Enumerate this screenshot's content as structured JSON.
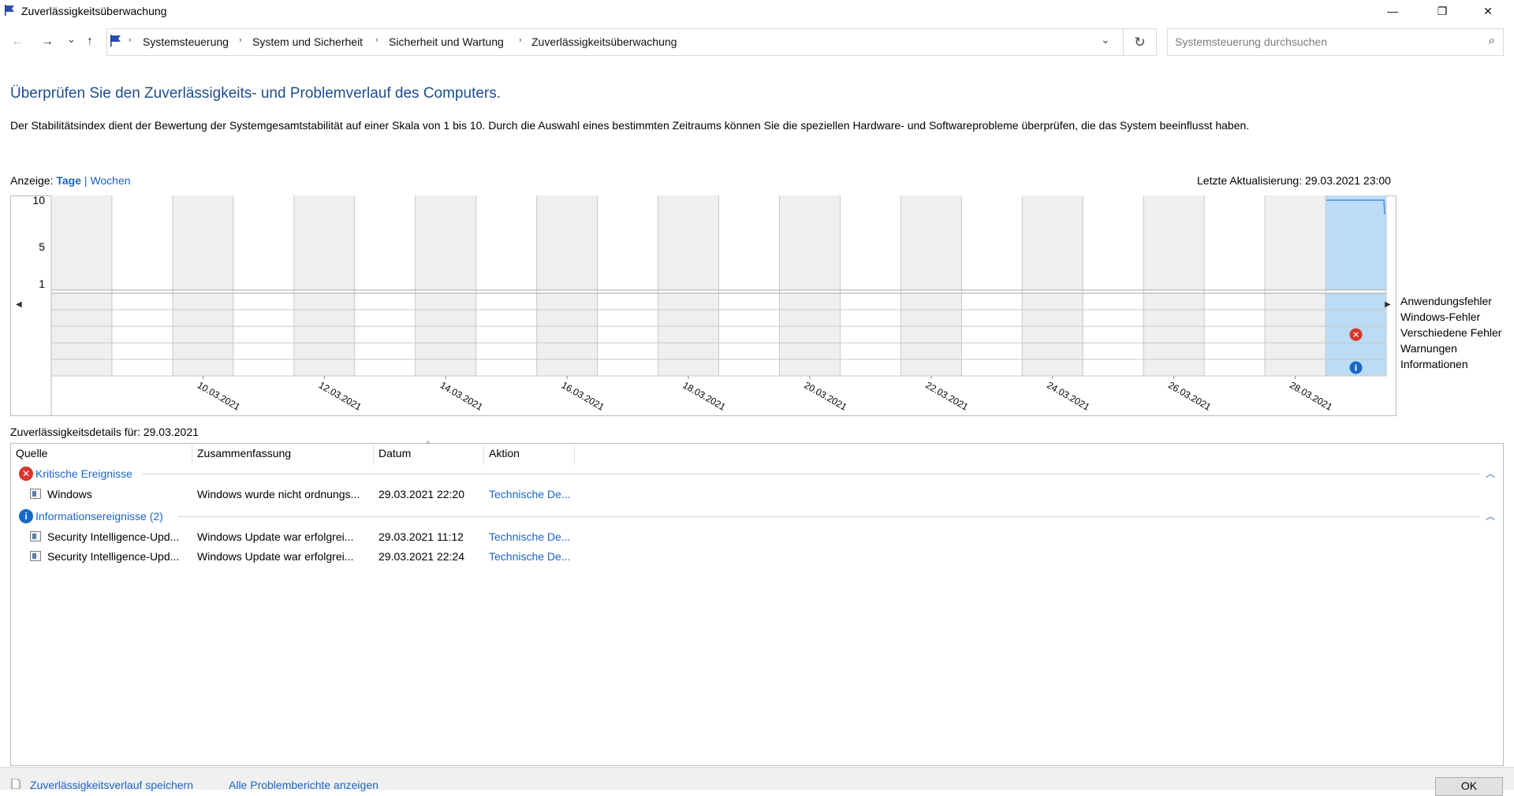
{
  "window": {
    "title": "Zuverlässigkeitsüberwachung",
    "icon": "flag-icon",
    "minimize_glyph": "—",
    "maximize_glyph": "❐",
    "close_glyph": "✕"
  },
  "nav": {
    "back_glyph": "←",
    "forward_glyph": "→",
    "recent_glyph": "⌄",
    "up_glyph": "↑",
    "breadcrumbs": [
      "Systemsteuerung",
      "System und Sicherheit",
      "Sicherheit und Wartung",
      "Zuverlässigkeitsüberwachung"
    ],
    "separator": "›",
    "dropdown_glyph": "⌄",
    "refresh_glyph": "↻"
  },
  "search": {
    "placeholder": "Systemsteuerung durchsuchen",
    "icon_glyph": "⌕"
  },
  "heading": "Überprüfen Sie den Zuverlässigkeits- und Problemverlauf des Computers.",
  "description": "Der Stabilitätsindex dient der Bewertung der Systemgesamtstabilität auf einer Skala von 1 bis 10. Durch die Auswahl eines bestimmten Zeitraums können Sie die speziellen Hardware- und Softwareprobleme überprüfen, die das System beeinflusst haben.",
  "view": {
    "label": "Anzeige:",
    "days": "Tage",
    "separator": "|",
    "weeks": "Wochen"
  },
  "last_update": "Letzte Aktualisierung: 29.03.2021 23:00",
  "chart_data": {
    "type": "line",
    "ylim": [
      1,
      10
    ],
    "y_ticks": [
      "10",
      "5",
      "1"
    ],
    "x_tick_labels": [
      "10.03.2021",
      "12.03.2021",
      "14.03.2021",
      "16.03.2021",
      "18.03.2021",
      "20.03.2021",
      "22.03.2021",
      "24.03.2021",
      "26.03.2021",
      "28.03.2021"
    ],
    "days": [
      "08.03.2021",
      "09.03.2021",
      "10.03.2021",
      "11.03.2021",
      "12.03.2021",
      "13.03.2021",
      "14.03.2021",
      "15.03.2021",
      "16.03.2021",
      "17.03.2021",
      "18.03.2021",
      "19.03.2021",
      "20.03.2021",
      "21.03.2021",
      "22.03.2021",
      "23.03.2021",
      "24.03.2021",
      "25.03.2021",
      "26.03.2021",
      "27.03.2021",
      "28.03.2021",
      "29.03.2021"
    ],
    "selected_day": "29.03.2021",
    "series": [
      {
        "values": [
          null,
          null,
          null,
          null,
          null,
          null,
          null,
          null,
          null,
          null,
          null,
          null,
          null,
          null,
          null,
          null,
          null,
          null,
          null,
          null,
          null,
          10
        ]
      }
    ],
    "event_rows": [
      "Anwendungsfehler",
      "Windows-Fehler",
      "Verschiedene Fehler",
      "Warnungen",
      "Informationen"
    ],
    "events": [
      {
        "day": "29.03.2021",
        "row": "Verschiedene Fehler",
        "kind": "error"
      },
      {
        "day": "29.03.2021",
        "row": "Informationen",
        "kind": "info"
      }
    ],
    "colors": {
      "selected": "#bcdcf5",
      "line": "#4a8fd6",
      "shaded": "#efefef",
      "grid": "#c8c8c8"
    }
  },
  "details": {
    "label": "Zuverlässigkeitsdetails für: 29.03.2021",
    "columns": [
      "Quelle",
      "Zusammenfassung",
      "Datum",
      "Aktion"
    ],
    "sort_glyph": "^",
    "groups": [
      {
        "title": "Kritische Ereignisse",
        "icon": "error-icon",
        "rows": [
          {
            "source": "Windows",
            "summary": "Windows wurde nicht ordnungs...",
            "date": "29.03.2021 22:20",
            "action": "Technische De..."
          }
        ]
      },
      {
        "title": "Informationsereignisse (2)",
        "icon": "info-icon",
        "rows": [
          {
            "source": "Security Intelligence-Upd...",
            "summary": "Windows Update war erfolgrei...",
            "date": "29.03.2021 11:12",
            "action": "Technische De..."
          },
          {
            "source": "Security Intelligence-Upd...",
            "summary": "Windows Update war erfolgrei...",
            "date": "29.03.2021 22:24",
            "action": "Technische De..."
          }
        ]
      }
    ]
  },
  "footer": {
    "save_link": "Zuverlässigkeitsverlauf speichern",
    "reports_link": "Alle Problemberichte anzeigen",
    "ok": "OK"
  }
}
